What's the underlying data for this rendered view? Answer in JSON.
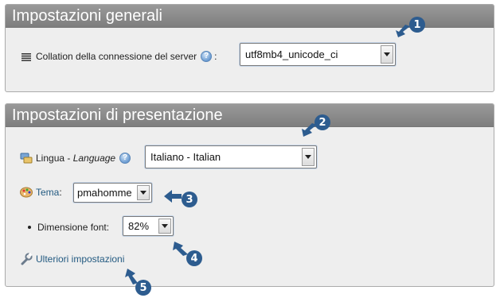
{
  "general": {
    "title": "Impostazioni generali",
    "collation_label": "Collation della connessione del server",
    "collation_colon": ":",
    "collation_value": "utf8mb4_unicode_ci"
  },
  "presentation": {
    "title": "Impostazioni di presentazione",
    "language_label": "Lingua - ",
    "language_label_en": "Language",
    "language_value": "Italiano - Italian",
    "theme_label": "Tema",
    "theme_colon": ":",
    "theme_value": "pmahomme",
    "font_size_label": "Dimensione font:",
    "font_size_value": "82%",
    "more_settings_label": "Ulteriori impostazioni"
  },
  "callouts": [
    "1",
    "2",
    "3",
    "4",
    "5"
  ],
  "colors": {
    "header": "#8a8a8a",
    "callout": "#2d5c8f",
    "link": "#235a81"
  }
}
